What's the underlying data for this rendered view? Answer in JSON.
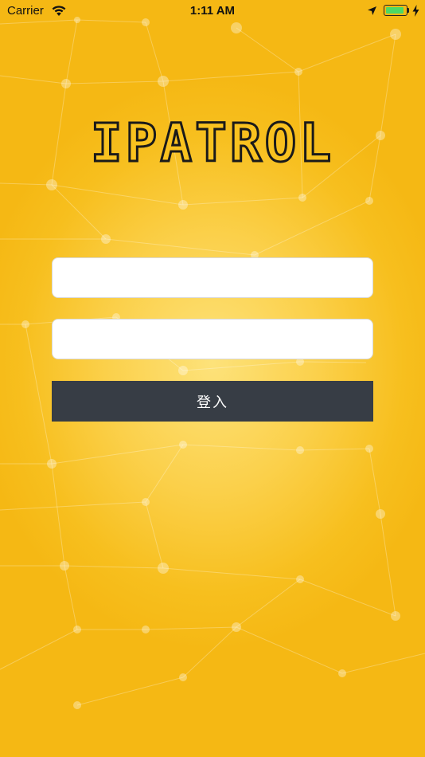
{
  "status_bar": {
    "carrier": "Carrier",
    "time": "1:11 AM",
    "battery_level": 0.95,
    "battery_color": "#4cd964"
  },
  "app": {
    "logo_text": "IPATROL"
  },
  "login_form": {
    "username": {
      "value": "",
      "placeholder": ""
    },
    "password": {
      "value": "",
      "placeholder": ""
    },
    "submit_label": "登入"
  },
  "colors": {
    "background_primary": "#f7bf1e",
    "background_highlight": "#fde27a",
    "button": "#373d45",
    "button_text": "#ffffff"
  },
  "icons": [
    "wifi-icon",
    "location-arrow-icon",
    "battery-icon",
    "charging-bolt-icon"
  ]
}
